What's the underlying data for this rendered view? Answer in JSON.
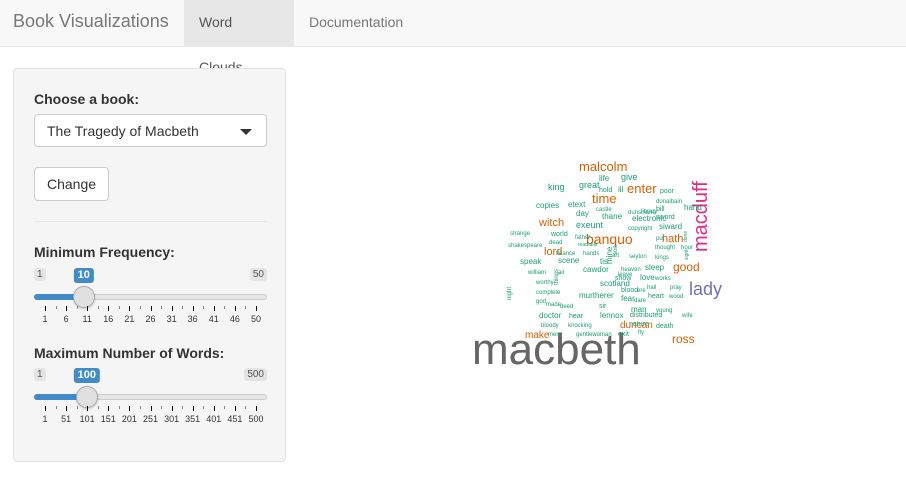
{
  "app": {
    "title": "Book Visualizations"
  },
  "tabs": [
    {
      "label": "Word Clouds",
      "active": true
    },
    {
      "label": "Documentation",
      "active": false
    }
  ],
  "sidebar": {
    "book_label": "Choose a book:",
    "book_selected": "The Tragedy of Macbeth",
    "change_label": "Change",
    "min_freq": {
      "label": "Minimum Frequency:",
      "min": 1,
      "max": 50,
      "value": 10,
      "min_text": "1",
      "max_text": "50",
      "value_text": "10",
      "ticks": [
        "1",
        "6",
        "11",
        "16",
        "21",
        "26",
        "31",
        "36",
        "41",
        "46",
        "50"
      ]
    },
    "max_words": {
      "label": "Maximum Number of Words:",
      "min": 1,
      "max": 500,
      "value": 100,
      "min_text": "1",
      "max_text": "500",
      "value_text": "100",
      "ticks": [
        "1",
        "51",
        "101",
        "151",
        "201",
        "251",
        "301",
        "351",
        "401",
        "451",
        "500"
      ]
    }
  },
  "colors": {
    "accent": "#428bca",
    "c_big": "#666666",
    "c_pink": "#e7298a",
    "c_purple": "#7570b3",
    "c_orange": "#d95f02",
    "c_green": "#1b9e77"
  },
  "wordcloud": [
    {
      "word": "macbeth",
      "size": 44,
      "color": "c_big"
    },
    {
      "word": "macduff",
      "size": 20,
      "color": "c_pink"
    },
    {
      "word": "lady",
      "size": 18,
      "color": "c_purple"
    },
    {
      "word": "banquo",
      "size": 14,
      "color": "c_orange"
    },
    {
      "word": "malcolm",
      "size": 13,
      "color": "c_orange"
    },
    {
      "word": "time",
      "size": 13,
      "color": "c_orange"
    },
    {
      "word": "enter",
      "size": 13,
      "color": "c_orange"
    },
    {
      "word": "ross",
      "size": 12,
      "color": "c_orange"
    },
    {
      "word": "good",
      "size": 12,
      "color": "c_orange"
    },
    {
      "word": "hath",
      "size": 11,
      "color": "c_orange"
    },
    {
      "word": "lord",
      "size": 11,
      "color": "c_orange"
    },
    {
      "word": "witch",
      "size": 11,
      "color": "c_orange"
    },
    {
      "word": "make",
      "size": 10,
      "color": "c_orange"
    },
    {
      "word": "duncan",
      "size": 10,
      "color": "c_orange"
    },
    {
      "word": "give",
      "size": 9,
      "color": "c_green"
    },
    {
      "word": "king",
      "size": 9,
      "color": "c_green"
    },
    {
      "word": "great",
      "size": 9,
      "color": "c_green"
    },
    {
      "word": "life",
      "size": 8,
      "color": "c_green"
    },
    {
      "word": "hold",
      "size": 7,
      "color": "c_green"
    },
    {
      "word": "ill",
      "size": 8,
      "color": "c_green"
    },
    {
      "word": "poor",
      "size": 7,
      "color": "c_green"
    },
    {
      "word": "donalbain",
      "size": 6,
      "color": "c_green"
    },
    {
      "word": "copies",
      "size": 8,
      "color": "c_green"
    },
    {
      "word": "etext",
      "size": 8,
      "color": "c_green"
    },
    {
      "word": "castle",
      "size": 6,
      "color": "c_green"
    },
    {
      "word": "library",
      "size": 6,
      "color": "c_green"
    },
    {
      "word": "bill",
      "size": 7,
      "color": "c_green"
    },
    {
      "word": "hand",
      "size": 8,
      "color": "c_green"
    },
    {
      "word": "day",
      "size": 8,
      "color": "c_green"
    },
    {
      "word": "thane",
      "size": 8,
      "color": "c_green"
    },
    {
      "word": "dunsinane",
      "size": 6,
      "color": "c_green"
    },
    {
      "word": "electronic",
      "size": 8,
      "color": "c_green"
    },
    {
      "word": "sword",
      "size": 7,
      "color": "c_green"
    },
    {
      "word": "exeunt",
      "size": 9,
      "color": "c_green"
    },
    {
      "word": "copyright",
      "size": 6,
      "color": "c_green"
    },
    {
      "word": "siward",
      "size": 8,
      "color": "c_green"
    },
    {
      "word": "strange",
      "size": 6,
      "color": "c_green"
    },
    {
      "word": "world",
      "size": 7,
      "color": "c_green"
    },
    {
      "word": "father",
      "size": 6,
      "color": "c_green"
    },
    {
      "word": "put",
      "size": 6,
      "color": "c_green"
    },
    {
      "word": "shakespeare",
      "size": 6,
      "color": "c_green"
    },
    {
      "word": "dead",
      "size": 6,
      "color": "c_green"
    },
    {
      "word": "readable",
      "size": 5,
      "color": "c_green"
    },
    {
      "word": "thought",
      "size": 6,
      "color": "c_green"
    },
    {
      "word": "hour",
      "size": 6,
      "color": "c_green"
    },
    {
      "word": "fleance",
      "size": 6,
      "color": "c_green"
    },
    {
      "word": "hands",
      "size": 6,
      "color": "c_green"
    },
    {
      "word": "art",
      "size": 6,
      "color": "c_green"
    },
    {
      "word": "seyton",
      "size": 6,
      "color": "c_green"
    },
    {
      "word": "kings",
      "size": 6,
      "color": "c_green"
    },
    {
      "word": "speak",
      "size": 8,
      "color": "c_green"
    },
    {
      "word": "scene",
      "size": 8,
      "color": "c_green"
    },
    {
      "word": "tis",
      "size": 8,
      "color": "c_green"
    },
    {
      "word": "mine",
      "size": 8,
      "color": "c_green"
    },
    {
      "word": "heaven",
      "size": 6,
      "color": "c_green"
    },
    {
      "word": "sleep",
      "size": 8,
      "color": "c_green"
    },
    {
      "word": "william",
      "size": 6,
      "color": "c_green"
    },
    {
      "word": "air",
      "size": 6,
      "color": "c_green"
    },
    {
      "word": "cawdor",
      "size": 8,
      "color": "c_green"
    },
    {
      "word": "leave",
      "size": 6,
      "color": "c_green"
    },
    {
      "word": "show",
      "size": 7,
      "color": "c_green"
    },
    {
      "word": "love",
      "size": 8,
      "color": "c_green"
    },
    {
      "word": "works",
      "size": 6,
      "color": "c_green"
    },
    {
      "word": "worthy",
      "size": 6,
      "color": "c_green"
    },
    {
      "word": "scotland",
      "size": 8,
      "color": "c_green"
    },
    {
      "word": "hail",
      "size": 6,
      "color": "c_green"
    },
    {
      "word": "pray",
      "size": 6,
      "color": "c_green"
    },
    {
      "word": "complete",
      "size": 6,
      "color": "c_green"
    },
    {
      "word": "murtherer",
      "size": 8,
      "color": "c_green"
    },
    {
      "word": "blood",
      "size": 7,
      "color": "c_green"
    },
    {
      "word": "ere",
      "size": 6,
      "color": "c_green"
    },
    {
      "word": "heart",
      "size": 7,
      "color": "c_green"
    },
    {
      "word": "wood",
      "size": 6,
      "color": "c_green"
    },
    {
      "word": "god",
      "size": 6,
      "color": "c_green"
    },
    {
      "word": "made",
      "size": 6,
      "color": "c_green"
    },
    {
      "word": "deed",
      "size": 6,
      "color": "c_green"
    },
    {
      "word": "sir",
      "size": 7,
      "color": "c_green"
    },
    {
      "word": "fear",
      "size": 8,
      "color": "c_green"
    },
    {
      "word": "dare",
      "size": 6,
      "color": "c_green"
    },
    {
      "word": "man",
      "size": 8,
      "color": "c_green"
    },
    {
      "word": "young",
      "size": 6,
      "color": "c_green"
    },
    {
      "word": "doctor",
      "size": 8,
      "color": "c_green"
    },
    {
      "word": "hear",
      "size": 7,
      "color": "c_green"
    },
    {
      "word": "lennox",
      "size": 8,
      "color": "c_green"
    },
    {
      "word": "distributed",
      "size": 7,
      "color": "c_green"
    },
    {
      "word": "wife",
      "size": 6,
      "color": "c_green"
    },
    {
      "word": "bloody",
      "size": 6,
      "color": "c_green"
    },
    {
      "word": "knocking",
      "size": 6,
      "color": "c_green"
    },
    {
      "word": "nature",
      "size": 7,
      "color": "c_green"
    },
    {
      "word": "death",
      "size": 7,
      "color": "c_green"
    },
    {
      "word": "men",
      "size": 6,
      "color": "c_green"
    },
    {
      "word": "gentlewoman",
      "size": 6,
      "color": "c_green"
    },
    {
      "word": "exit",
      "size": 7,
      "color": "c_green"
    },
    {
      "word": "fly",
      "size": 6,
      "color": "c_green"
    },
    {
      "word": "night",
      "size": 6,
      "color": "c_green"
    },
    {
      "word": "things",
      "size": 6,
      "color": "c_green"
    },
    {
      "word": "son",
      "size": 6,
      "color": "c_green"
    },
    {
      "word": "done",
      "size": 5,
      "color": "c_green"
    },
    {
      "word": "sight",
      "size": 5,
      "color": "c_green"
    }
  ]
}
